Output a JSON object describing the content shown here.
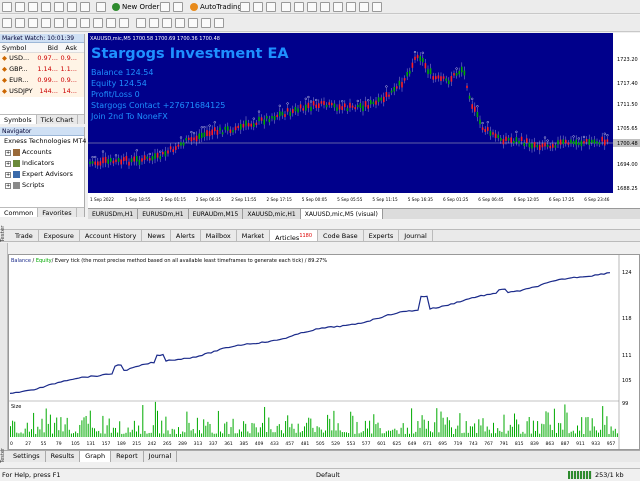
{
  "toolbar": {
    "new_order": "New Order",
    "autotrading": "AutoTrading"
  },
  "market_watch": {
    "title": "Market Watch: 10:01:39",
    "headers": [
      "Symbol",
      "Bid",
      "Ask"
    ],
    "rows": [
      {
        "symbol": "USD...",
        "bid": "0.97...",
        "ask": "0.9..."
      },
      {
        "symbol": "GBP...",
        "bid": "1.14...",
        "ask": "1.1..."
      },
      {
        "symbol": "EUR...",
        "bid": "0.99...",
        "ask": "0.9..."
      },
      {
        "symbol": "USDJPY",
        "bid": "144...",
        "ask": "14..."
      }
    ],
    "tabs": [
      "Symbols",
      "Tick Chart"
    ]
  },
  "navigator": {
    "title": "Navigator",
    "items": [
      "Exness Technologies MT4",
      "Accounts",
      "Indicators",
      "Expert Advisors",
      "Scripts"
    ],
    "tabs": [
      "Common",
      "Favorites"
    ]
  },
  "chart": {
    "header": "XAUUSD,mic,M5  1700.58 1700.69 1700.36 1700.48",
    "ea_name": "Stargogs Investment EA",
    "balance": "Balance 124.54",
    "equity": "Equity 124.54",
    "profit": "Profit/Loss 0",
    "contact": "Stargogs Contact +27671684125",
    "join": "Join 2nd To NoneFX",
    "price_labels": [
      "1723.20",
      "1717.40",
      "1711.50",
      "1705.65",
      "1700.48",
      "1694.00",
      "1688.25"
    ],
    "current_price": "1700.48",
    "time_labels": [
      "1 Sep 2022",
      "1 Sep 18:55",
      "2 Sep 01:15",
      "2 Sep 06:35",
      "2 Sep 11:55",
      "2 Sep 17:15",
      "5 Sep 00:05",
      "5 Sep 05:55",
      "5 Sep 11:15",
      "5 Sep 16:35",
      "6 Sep 01:25",
      "6 Sep 06:45",
      "6 Sep 12:05",
      "6 Sep 17:25",
      "6 Sep 23:46"
    ],
    "tabs": [
      "EURUSDm,H1",
      "EURUSDm,H1",
      "EURAUDm,M15",
      "XAUUSD,mic,H1",
      "XAUUSD,mic,M5 (visual)"
    ],
    "colors": {
      "bg": "#00008b",
      "bull": "#00aa00",
      "bear": "#ff2020",
      "marker": "#ffffff"
    }
  },
  "terminal": {
    "label": "Tester",
    "tabs": [
      "Trade",
      "Exposure",
      "Account History",
      "News",
      "Alerts",
      "Mailbox",
      "Market",
      "Articles",
      "Code Base",
      "Experts",
      "Journal"
    ],
    "articles_badge": "1180"
  },
  "graph": {
    "legend_balance": "Balance",
    "legend_equity": "Equity",
    "legend_rest": "/ Every tick (the most precise method based on all available least timeframes to generate each tick) / 89.27%",
    "y_labels": [
      "124",
      "118",
      "111",
      "105",
      "99"
    ],
    "size_label": "Size",
    "x_labels": [
      "0",
      "27",
      "55",
      "79",
      "105",
      "131",
      "157",
      "189",
      "215",
      "242",
      "265",
      "289",
      "313",
      "337",
      "361",
      "385",
      "409",
      "433",
      "457",
      "481",
      "505",
      "529",
      "553",
      "577",
      "601",
      "625",
      "649",
      "671",
      "695",
      "719",
      "743",
      "767",
      "791",
      "815",
      "839",
      "863",
      "887",
      "911",
      "933",
      "957"
    ],
    "colors": {
      "balance": "#1a2a8a",
      "equity": "#00aa00",
      "volume": "#00aa00"
    }
  },
  "bottom_tabs": [
    "Settings",
    "Results",
    "Graph",
    "Report",
    "Journal"
  ],
  "bottom_label": "Tester",
  "status": {
    "help": "For Help, press F1",
    "profile": "Default",
    "traffic": "253/1 kb"
  }
}
